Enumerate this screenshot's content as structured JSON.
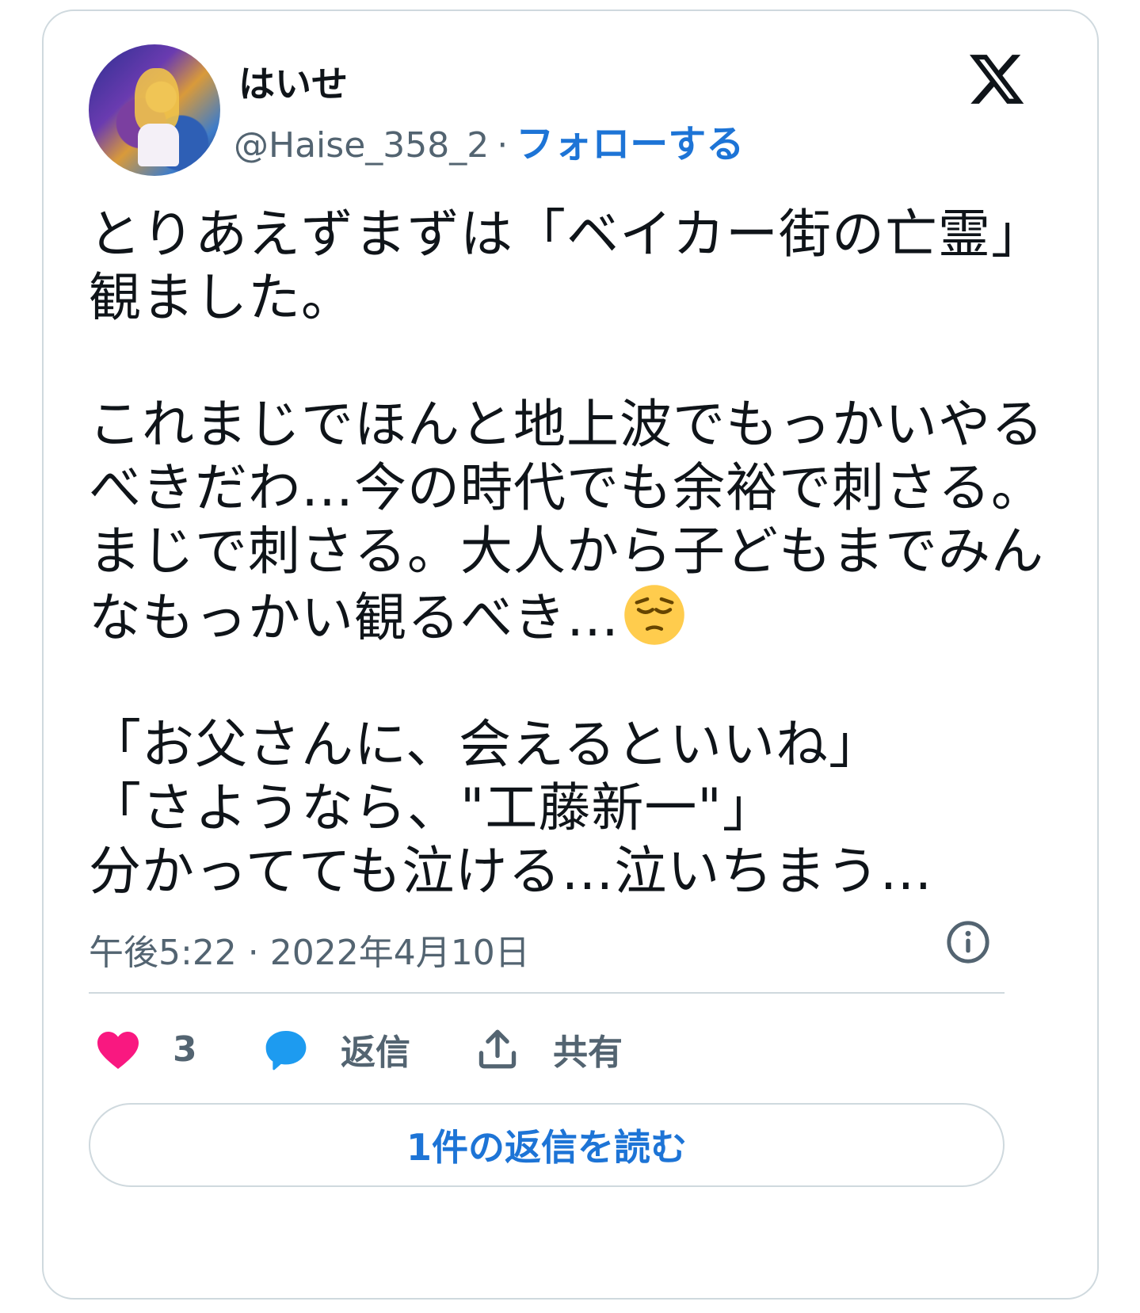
{
  "user": {
    "display_name": "はいせ",
    "handle": "@Haise_358_2",
    "separator": "·",
    "follow_label": "フォローする"
  },
  "tweet": {
    "text": "とりあえずまずは「ベイカー街の亡霊」観ました。\n\nこれまじでほんと地上波でもっかいやるべきだわ…今の時代でも余裕で刺さる。まじで刺さる。大人から子どもまでみんなもっかい観るべき…",
    "text_after_emoji": "\n\n「お父さんに、会えるといいね」\n「さようなら、\"工藤新一\"」\n分かってても泣ける…泣いちまう…",
    "emoji": "pensive-face",
    "timestamp": "午後5:22 · 2022年4月10日"
  },
  "actions": {
    "like_count": "3",
    "reply_label": "返信",
    "share_label": "共有"
  },
  "read_replies_label": "1件の返信を読む",
  "colors": {
    "accent": "#1d74d6",
    "like": "#f91880",
    "reply": "#1d9bf0",
    "muted": "#536471",
    "border": "#cfd9de"
  }
}
